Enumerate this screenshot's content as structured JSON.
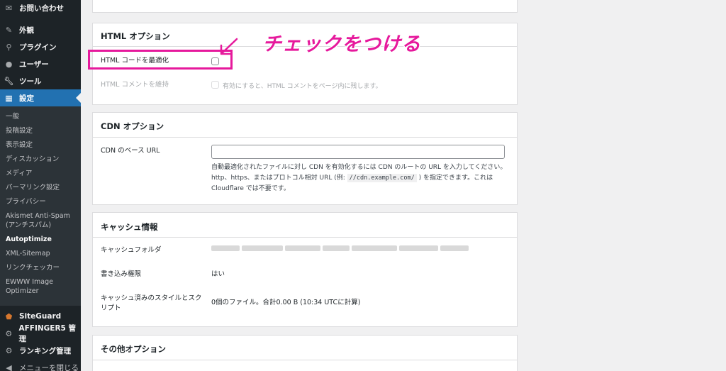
{
  "sidebar": {
    "top_items": [
      {
        "label": "お問い合わせ",
        "icon": "mail-icon"
      },
      {
        "label": "外観",
        "icon": "brush-icon"
      },
      {
        "label": "プラグイン",
        "icon": "plugin-icon"
      },
      {
        "label": "ユーザー",
        "icon": "user-icon"
      },
      {
        "label": "ツール",
        "icon": "wrench-icon"
      }
    ],
    "active_item": {
      "label": "設定",
      "icon": "settings-icon"
    },
    "submenu": [
      "一般",
      "投稿設定",
      "表示設定",
      "ディスカッション",
      "メディア",
      "パーマリンク設定",
      "プライバシー",
      "Akismet Anti-Spam (アンチスパム)",
      "Autoptimize",
      "XML-Sitemap",
      "リンクチェッカー",
      "EWWW Image Optimizer"
    ],
    "bottom_items": [
      {
        "label": "SiteGuard",
        "icon": "shield-icon"
      },
      {
        "label": "AFFINGER5 管理",
        "icon": "gear-icon"
      },
      {
        "label": "ランキング管理",
        "icon": "gear-icon"
      },
      {
        "label": "メニューを閉じる",
        "icon": "collapse-icon"
      }
    ]
  },
  "html_options": {
    "title": "HTML オプション",
    "optimize_label": "HTML コードを最適化",
    "keep_comments_label": "HTML コメントを維持",
    "keep_comments_hint": "有効にすると、HTML コメントをページ内に残します。"
  },
  "cdn_options": {
    "title": "CDN オプション",
    "base_url_label": "CDN のベース URL",
    "base_url_value": "",
    "desc_part1": "自動最適化されたファイルに対し CDN を有効化するには CDN のルートの URL を入力してください。http、https、またはプロトコル相対 URL (例: ",
    "desc_code": "//cdn.example.com/",
    "desc_part2": " ) を指定できます。これは Cloudflare では不要です。"
  },
  "cache_info": {
    "title": "キャッシュ情報",
    "folder_label": "キャッシュフォルダ",
    "write_label": "書き込み権限",
    "write_value": "はい",
    "cached_label": "キャッシュ済みのスタイルとスクリプト",
    "cached_value": "0個のファイル。合計0.00 B (10:34 UTCに計算)"
  },
  "other_options": {
    "title": "その他オプション"
  },
  "annotation": {
    "text": "チェックをつける",
    "color": "#e6199c"
  },
  "colors": {
    "sidebar_bg": "#1d2327",
    "active_bg": "#2271b1",
    "annotation": "#e6199c"
  }
}
